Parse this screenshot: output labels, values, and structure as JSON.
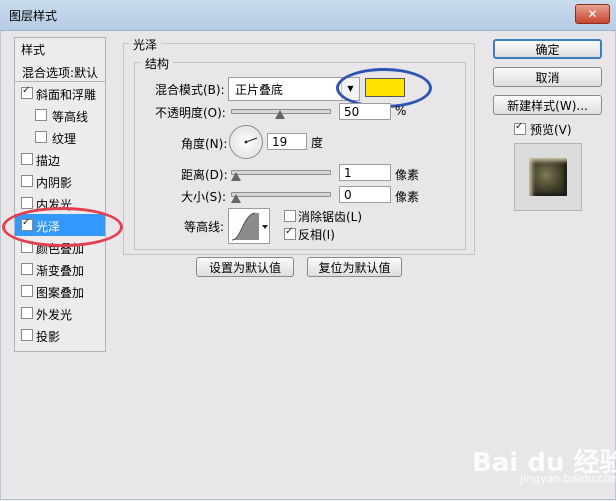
{
  "window": {
    "title": "图层样式",
    "close_symbol": "✕"
  },
  "style_list": {
    "header": "样式",
    "items": [
      {
        "label": "混合选项:默认",
        "checkbox": false,
        "checked": false,
        "sub": false,
        "selected": false
      },
      {
        "label": "斜面和浮雕",
        "checkbox": true,
        "checked": true,
        "sub": false,
        "selected": false
      },
      {
        "label": "等高线",
        "checkbox": true,
        "checked": false,
        "sub": true,
        "selected": false
      },
      {
        "label": "纹理",
        "checkbox": true,
        "checked": false,
        "sub": true,
        "selected": false
      },
      {
        "label": "描边",
        "checkbox": true,
        "checked": false,
        "sub": false,
        "selected": false
      },
      {
        "label": "内阴影",
        "checkbox": true,
        "checked": false,
        "sub": false,
        "selected": false
      },
      {
        "label": "内发光",
        "checkbox": true,
        "checked": false,
        "sub": false,
        "selected": false
      },
      {
        "label": "光泽",
        "checkbox": true,
        "checked": true,
        "sub": false,
        "selected": true
      },
      {
        "label": "颜色叠加",
        "checkbox": true,
        "checked": false,
        "sub": false,
        "selected": false
      },
      {
        "label": "渐变叠加",
        "checkbox": true,
        "checked": false,
        "sub": false,
        "selected": false
      },
      {
        "label": "图案叠加",
        "checkbox": true,
        "checked": false,
        "sub": false,
        "selected": false
      },
      {
        "label": "外发光",
        "checkbox": true,
        "checked": false,
        "sub": false,
        "selected": false
      },
      {
        "label": "投影",
        "checkbox": true,
        "checked": false,
        "sub": false,
        "selected": false
      }
    ]
  },
  "satin": {
    "group_title": "光泽",
    "structure_title": "结构",
    "blend_mode_label": "混合模式(B):",
    "blend_mode_value": "正片叠底",
    "blend_color": "#ffe300",
    "opacity_label": "不透明度(O):",
    "opacity_value": "50",
    "opacity_unit": "%",
    "angle_label": "角度(N):",
    "angle_value": "19",
    "angle_unit": "度",
    "distance_label": "距离(D):",
    "distance_value": "1",
    "distance_unit": "像素",
    "size_label": "大小(S):",
    "size_value": "0",
    "size_unit": "像素",
    "contour_label": "等高线:",
    "antialias_label": "消除锯齿(L)",
    "antialias_checked": false,
    "invert_label": "反相(I)",
    "invert_checked": true,
    "set_default_label": "设置为默认值",
    "reset_default_label": "复位为默认值"
  },
  "buttons": {
    "ok": "确定",
    "cancel": "取消",
    "new_style": "新建样式(W)...",
    "preview_label": "预览(V)",
    "preview_checked": true
  },
  "watermark": {
    "text": "Bai du 经验",
    "sub": "jingyan.baidu.com"
  }
}
